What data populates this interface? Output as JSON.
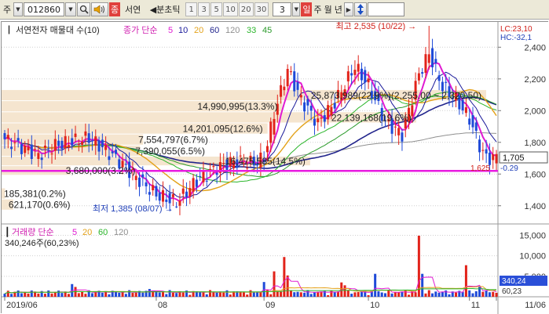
{
  "toolbar": {
    "market_label": "주",
    "market_dropdown_arrow": "▼",
    "stock_code": "012860",
    "stock_name": "서연",
    "name_prefix": "종",
    "period_label": "◀분초틱",
    "periods": [
      "1",
      "3",
      "5",
      "10",
      "20",
      "30"
    ],
    "count_value": "3",
    "period_unit_day": "일",
    "period_units": [
      "주",
      "월",
      "년"
    ],
    "period_arrow": "▶"
  },
  "chart_data": {
    "type": "candlestick",
    "title": "서연전자 매물대 수(10)",
    "ma_legend_prefix": "종가 단순",
    "ma_periods": [
      {
        "label": "5",
        "color": "#e01ad2"
      },
      {
        "label": "10",
        "color": "#1a1a9a"
      },
      {
        "label": "20",
        "color": "#e3a21a"
      },
      {
        "label": "60",
        "color": "#22258c"
      },
      {
        "label": "120",
        "color": "#8f8f8f"
      },
      {
        "label": "33",
        "color": "#2ab52a"
      },
      {
        "label": "45",
        "color": "#2a9a2a"
      }
    ],
    "price_axis": {
      "min": 1300,
      "max": 2520,
      "ticks": [
        1400,
        1600,
        1800,
        2000,
        2200,
        2400
      ]
    },
    "volume_axis": {
      "min": 0,
      "max": 17000,
      "ticks": [
        5000,
        10000,
        15000
      ]
    },
    "x_labels": [
      {
        "label": "2019/06",
        "index": 0
      },
      {
        "label": "08",
        "index": 45
      },
      {
        "label": "09",
        "index": 77
      },
      {
        "label": "10",
        "index": 108
      },
      {
        "label": "11",
        "index": 138
      },
      {
        "label": "11/06",
        "index": 146
      }
    ],
    "volume_profile": [
      {
        "label": "621,170(0.6%)",
        "value": 621170,
        "price_low": 1370,
        "price_high": 1440
      },
      {
        "label": "185,381(0.2%)",
        "value": 185381,
        "price_low": 1440,
        "price_high": 1510
      },
      {
        "label": "3,680,000(3.2%)",
        "value": 3680000,
        "price_low": 1590,
        "price_high": 1650
      },
      {
        "label": "16,475,585(14.5%)",
        "value": 16475585,
        "price_low": 1650,
        "price_high": 1710
      },
      {
        "label": "7,390,055(6.5%)",
        "value": 7390055,
        "price_low": 1710,
        "price_high": 1780
      },
      {
        "label": "7,554,797(6.7%)",
        "value": 7554797,
        "price_low": 1780,
        "price_high": 1850
      },
      {
        "label": "14,201,095(12.6%)",
        "value": 14201095,
        "price_low": 1850,
        "price_high": 1920
      },
      {
        "label": "22,139,168(19.6%)",
        "value": 22139168,
        "price_low": 1920,
        "price_high": 1990
      },
      {
        "label": "14,990,995(13.3%)",
        "value": 14990995,
        "price_low": 1990,
        "price_high": 2060
      },
      {
        "label": "25,873,989(22.9%)(2,255.00 ~ 2,320.50)",
        "value": 25873989,
        "price_low": 2060,
        "price_high": 2130
      }
    ],
    "annotations": {
      "high_label": "최고 2,535 (10/22)",
      "high_price": 2535,
      "high_index": 126,
      "low_label": "최저 1,385 (08/07)",
      "low_price": 1385,
      "low_index": 51,
      "current_price": "1,705",
      "current_value": 1705,
      "change_text": "-0.29",
      "sub_price": "1,625",
      "lc_text": "LC:23,10",
      "hc_text": "HC:-32,1"
    },
    "reference_lines": [
      {
        "price": 1620,
        "color": "#e81ce0"
      }
    ],
    "volume_panel": {
      "title_prefix": "거래량 단순",
      "ma_periods": [
        {
          "label": "5",
          "color": "#e01ad2"
        },
        {
          "label": "20",
          "color": "#e3a21a"
        },
        {
          "label": "60",
          "color": "#2ab52a"
        },
        {
          "label": "120",
          "color": "#8f8f8f"
        }
      ],
      "current_label": "340,246주(60,23%)",
      "current_box": "340,24",
      "current_sub": "60,23"
    }
  }
}
